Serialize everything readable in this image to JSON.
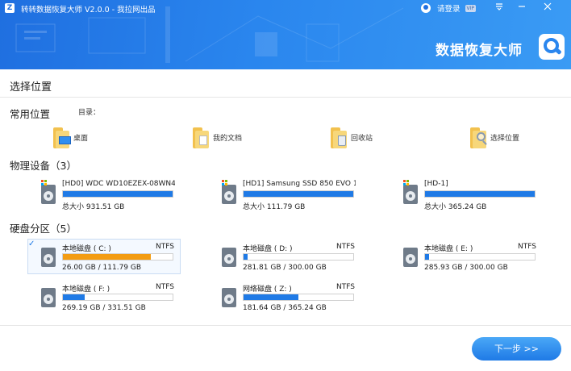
{
  "app": {
    "logo_letter": "Z",
    "title": "转转数据恢复大师 V2.0.0",
    "separator": "-",
    "subtitle": "我拉网出品",
    "login_label": "请登录",
    "vip_badge": "VIP",
    "brand_text": "数据恢复大师"
  },
  "colors": {
    "header_start": "#1f6fe0",
    "header_end": "#3a9bf4",
    "bar_blue": "#1f7ae6",
    "bar_orange": "#f39c12",
    "button_blue": "#1f7ae6"
  },
  "page": {
    "title": "选择位置"
  },
  "common": {
    "title": "常用位置",
    "dir_label": "目录：",
    "items": [
      {
        "label": "桌面",
        "icon": "desktop-folder-icon"
      },
      {
        "label": "我的文档",
        "icon": "documents-folder-icon"
      },
      {
        "label": "回收站",
        "icon": "recycle-bin-folder-icon"
      },
      {
        "label": "选择位置",
        "icon": "browse-folder-icon"
      }
    ]
  },
  "physical": {
    "title": "物理设备（3）",
    "items": [
      {
        "name": "[HD0] WDC WD10EZEX-08WN4...",
        "size": "总大小 931.51 GB",
        "used_fraction": 1.0
      },
      {
        "name": "[HD1] Samsung SSD 850 EVO 1...",
        "size": "总大小 111.79 GB",
        "used_fraction": 1.0
      },
      {
        "name": "[HD-1]",
        "size": "总大小 365.24 GB",
        "used_fraction": 1.0
      }
    ]
  },
  "partitions": {
    "title": "硬盘分区（5）",
    "items": [
      {
        "name": "本地磁盘 ( C: )",
        "fs": "NTFS",
        "size": "26.00 GB / 111.79 GB",
        "used_fraction": 0.8,
        "color": "#f39c12",
        "selected": true
      },
      {
        "name": "本地磁盘 ( D: )",
        "fs": "NTFS",
        "size": "281.81 GB / 300.00 GB",
        "used_fraction": 0.04,
        "color": "#1f7ae6",
        "selected": false
      },
      {
        "name": "本地磁盘 ( E: )",
        "fs": "NTFS",
        "size": "285.93 GB / 300.00 GB",
        "used_fraction": 0.04,
        "color": "#1f7ae6",
        "selected": false
      },
      {
        "name": "本地磁盘 ( F: )",
        "fs": "NTFS",
        "size": "269.19 GB / 331.51 GB",
        "used_fraction": 0.2,
        "color": "#1f7ae6",
        "selected": false
      },
      {
        "name": "网络磁盘 ( Z: )",
        "fs": "NTFS",
        "size": "181.64 GB / 365.24 GB",
        "used_fraction": 0.5,
        "color": "#1f7ae6",
        "selected": false
      }
    ]
  },
  "footer": {
    "next_label": "下一步 >>"
  }
}
